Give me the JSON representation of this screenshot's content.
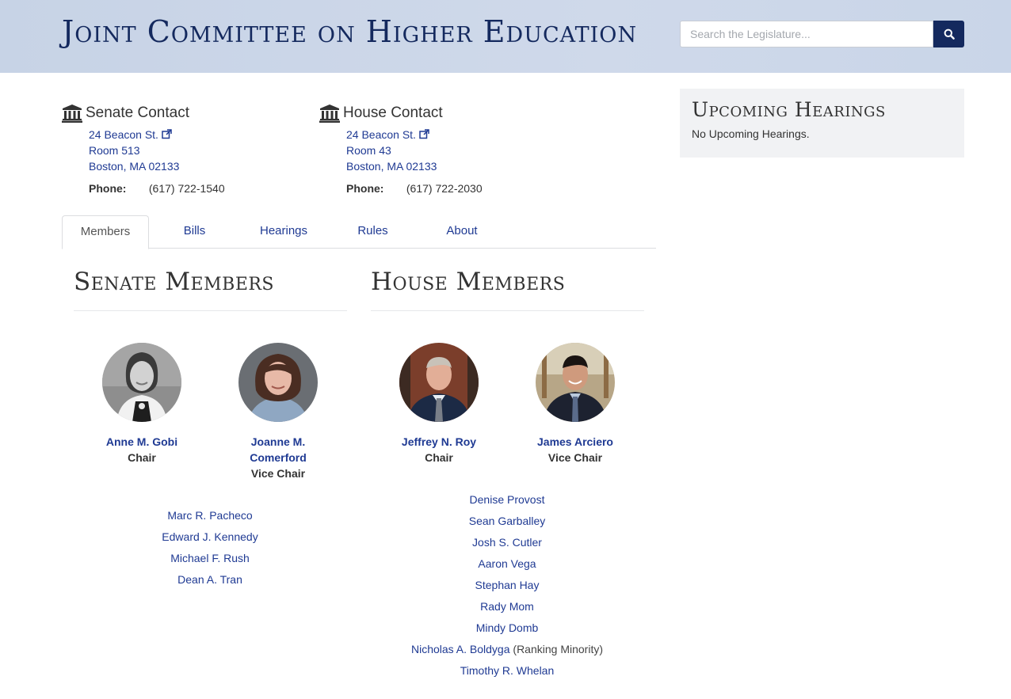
{
  "header": {
    "title": "Joint Committee on Higher Education",
    "search_placeholder": "Search the Legislature..."
  },
  "senate_contact": {
    "title": "Senate Contact",
    "address1": "24 Beacon St.",
    "address2": "Room 513",
    "address3": "Boston, MA 02133",
    "phone_label": "Phone:",
    "phone": "(617) 722-1540"
  },
  "house_contact": {
    "title": "House Contact",
    "address1": "24 Beacon St.",
    "address2": "Room 43",
    "address3": "Boston, MA 02133",
    "phone_label": "Phone:",
    "phone": "(617) 722-2030"
  },
  "upcoming": {
    "title": "Upcoming Hearings",
    "empty_text": "No Upcoming Hearings."
  },
  "tabs": [
    {
      "label": "Members",
      "active": true
    },
    {
      "label": "Bills",
      "active": false
    },
    {
      "label": "Hearings",
      "active": false
    },
    {
      "label": "Rules",
      "active": false
    },
    {
      "label": "About",
      "active": false
    }
  ],
  "senate": {
    "heading": "Senate Members",
    "leaders": [
      {
        "name": "Anne M. Gobi",
        "role": "Chair"
      },
      {
        "name_line1": "Joanne M.",
        "name_line2": "Comerford",
        "role": "Vice Chair"
      }
    ],
    "members": [
      "Marc R. Pacheco",
      "Edward J. Kennedy",
      "Michael F. Rush",
      "Dean A. Tran"
    ]
  },
  "house": {
    "heading": "House Members",
    "leaders": [
      {
        "name": "Jeffrey N. Roy",
        "role": "Chair"
      },
      {
        "name": "James Arciero",
        "role": "Vice Chair"
      }
    ],
    "members": [
      "Denise Provost",
      "Sean Garballey",
      "Josh S. Cutler",
      "Aaron Vega",
      "Stephan Hay",
      "Rady Mom",
      "Mindy Domb",
      "Nicholas A. Boldyga",
      "Timothy R. Whelan"
    ],
    "minority_note": "(Ranking Minority)"
  },
  "colors": {
    "navy": "#14295e",
    "link": "#1f3a93",
    "header_bg": "#c9d5e8"
  }
}
